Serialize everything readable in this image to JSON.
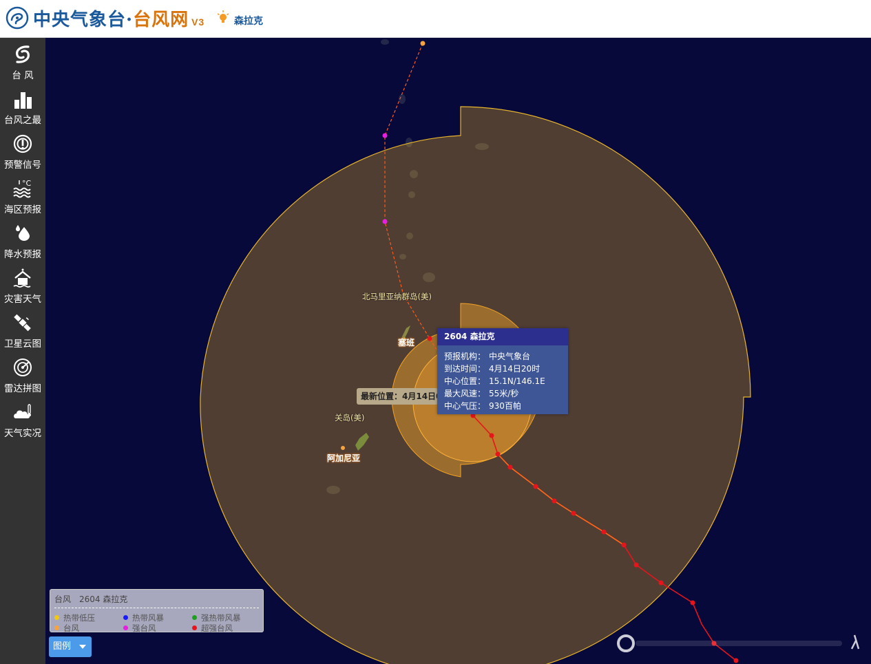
{
  "header": {
    "site_name_part1": "中央气象台·",
    "site_name_part2": "台风网",
    "version": "V3",
    "current_typhoon": "森拉克"
  },
  "sidebar": {
    "items": [
      {
        "label": "台 风",
        "icon": "typhoon-icon"
      },
      {
        "label": "台风之最",
        "icon": "bar-chart-icon"
      },
      {
        "label": "预警信号",
        "icon": "warning-signal-icon"
      },
      {
        "label": "海区预报",
        "icon": "sea-temperature-icon"
      },
      {
        "label": "降水预报",
        "icon": "raindrop-icon"
      },
      {
        "label": "灾害天气",
        "icon": "disaster-house-icon"
      },
      {
        "label": "卫星云图",
        "icon": "satellite-icon"
      },
      {
        "label": "雷达拼图",
        "icon": "radar-icon"
      },
      {
        "label": "天气实况",
        "icon": "weather-cloud-icon"
      }
    ]
  },
  "map": {
    "place_labels": {
      "north_marianas": "北马里亚纳群岛(美)",
      "saipan": "塞班",
      "guam": "关岛(美)",
      "hagatna": "阿加尼亚"
    },
    "latest_position": "最新位置：4月14日08时",
    "popup": {
      "title": "2604 森拉克",
      "rows": [
        {
          "key": "预报机构：",
          "value": "中央气象台"
        },
        {
          "key": "到达时间：",
          "value": "4月14日20时"
        },
        {
          "key": "中心位置：",
          "value": "15.1N/146.1E"
        },
        {
          "key": "最大风速：",
          "value": "55米/秒"
        },
        {
          "key": "中心气压：",
          "value": "930百帕"
        }
      ]
    },
    "colors": {
      "ocean": "#07093a",
      "wind_circle_7": "#d8a021",
      "wind_circle_10": "#f3a325",
      "track_super_typhoon": "#e8141b",
      "forecast_line": "#ff5a1a"
    }
  },
  "legend": {
    "title_kind": "台风",
    "title_name": "2604 森拉克",
    "items": [
      {
        "label": "热带低压",
        "color": "#f2c811"
      },
      {
        "label": "热带风暴",
        "color": "#1a1aff"
      },
      {
        "label": "强热带风暴",
        "color": "#1f9f1f"
      },
      {
        "label": "台风",
        "color": "#f7a440"
      },
      {
        "label": "强台风",
        "color": "#e81ee0"
      },
      {
        "label": "超强台风",
        "color": "#e8141b"
      }
    ],
    "button_label": "图例"
  }
}
